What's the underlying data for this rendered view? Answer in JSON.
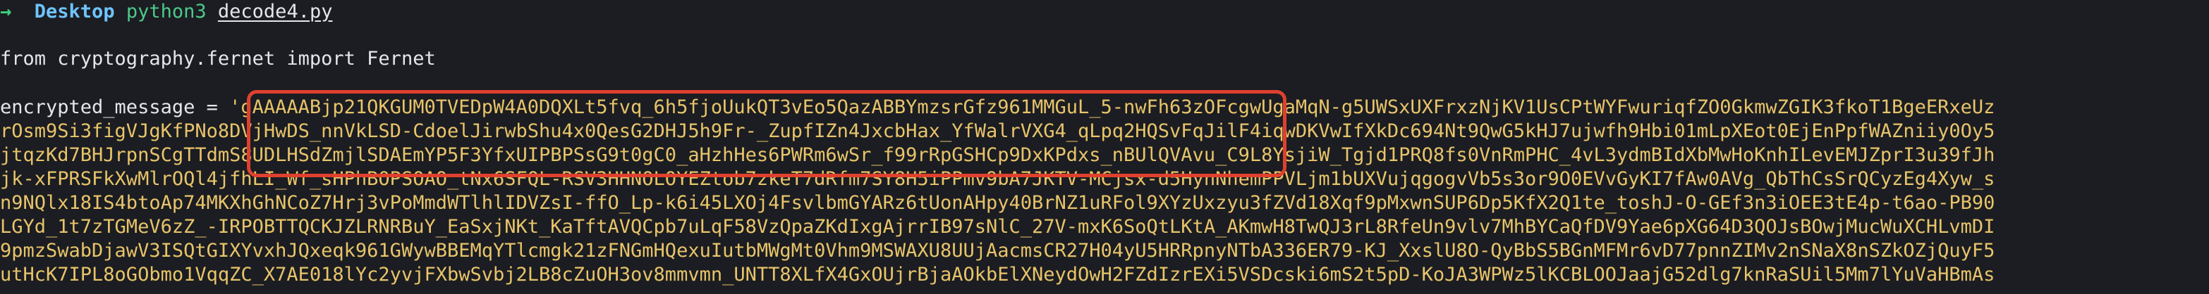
{
  "terminal": {
    "prompt_arrow": "→",
    "prompt_dir": "Desktop",
    "prompt_cmd": "python3",
    "prompt_arg": "decode4.py",
    "import_line": "from cryptography.fernet import Fernet",
    "assign_prefix": "encrypted_message = ",
    "string_lines": [
      "'gAAAAABjp21QKGUM0TVEDpW4A0DQXLt5fvq_6h5fjoUukQT3vEo5QazABBYmzsrGfz961MMGuL_5-nwFh63zOFcgwUgaMqN-g5UWSxUXFrxzNjKV1UsCPtWYFwuriqfZO0GkmwZGIK3fkoT1BgeERxeUz",
      "rOsm9Si3figVJgKfPNo8DVjHwDS_nnVkLSD-CdoelJirwbShu4x0QesG2DHJ5h9Fr-_ZupfIZn4JxcbHax_YfWalrVXG4_qLpq2HQSvFqJilF4iqwDKVwIfXkDc694Nt9QwG5kHJ7ujwfh9Hbi01mLpXEot0EjEnPpfWAZniiy0Oy5",
      "jtqzKd7BHJrpnSCgTTdmS8UDLHSdZmjlSDAEmYP5F3YfxUIPBPSsG9t0gC0_aHzhHes6PWRm6wSr_f99rRpGSHCp9DxKPdxs_nBUlQVAvu_C9L8YsjiW_Tgjd1PRQ8fs0VnRmPHC_4vL3ydmBIdXbMwHoKnhILevEMJZprI3u39fJh",
      "jk-xFPRSFkXwMlrOQl4jfhLI_Wf_sHPhBOPSOAO_tNx6SFQL-RSV3HHNOLOYEZtob7zkeT7dRfm7SY8H5iPPmv9bA7JKTV-MCjsx-d5HynNhemPPVLjm1bUXVujqgogvVb5s3or9O0EVvGyKI7fAw0AVg_QbThCsSrQCyzEg4Xyw_s",
      "n9NQlx18IS4btoAp74MKXhGhNCoZ7Hrj3vPoMmdWTlhlIDVZsI-ffO_Lp-k6i45LXOj4FsvlbmGYARz6tUonAHpy40BrNZ1uRFol9XYzUxzyu3fZVd18Xqf9pMxwnSUP6Dp5KfX2Q1te_toshJ-O-GEf3n3iOEE3tE4p-t6ao-PB90",
      "LGYd_1t7zTGMeV6zZ_-IRPOBTTQCKJZLRNRBuY_EaSxjNKt_KaTftAVQCpb7uLqF58VzQpaZKdIxgAjrrIB97sNlC_27V-mxK6SoQtLKtA_AKmwH8TwQJ3rL8RfeUn9vlv7MhBYCaQfDV9Yae6pXG64D3QOJsBOwjMucWuXCHLvmDI",
      "9pmzSwabDjawV3ISQtGIXYvxhJQxeqk961GWywBBEMqYTlcmgk21zFNGmHQexuIutbMWgMt0Vhm9MSWAXU8UUjAacmsCR27H04yU5HRRpnyNTbA336ER79-KJ_XxslU8O-QyBbS5BGnMFMr6vD77pnnZIMv2nSNaX8nSZkOZjQuyF5",
      "utHcK7IPL8oGObmo1VqqZC_X7AE018lYc2yvjFXbwSvbj2LB8cZuOH3ov8mmvmn_UNTT8XLfX4GxOUjrBjaAOkbElXNeydOwH2FZdIzrEXi5VSDcski6mS2t5pD-KoJA3WPWz5lKCBLOOJaajG52dlg7knRaSUil5Mm7lYuVaHBmAs"
    ]
  },
  "highlight": {
    "color": "#e0402e"
  }
}
